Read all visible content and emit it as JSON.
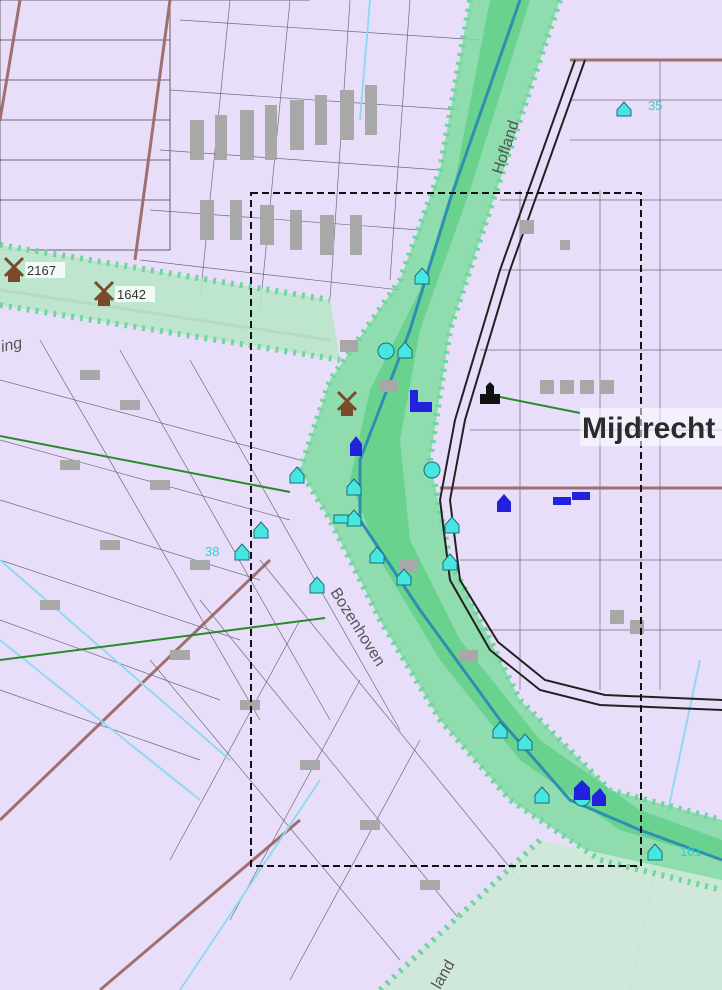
{
  "map": {
    "background_color": "#e9defa",
    "zone_color": "#5fd18a",
    "building_color": "#a8a8a8",
    "water_color": "#8fd9f2",
    "place_label": "Mijdrecht",
    "street_labels": [
      "Hofland",
      "Bozenhoven",
      "ing",
      "land"
    ],
    "windmills": [
      {
        "id": "2167",
        "label": "2167",
        "icon": "windmill-x-icon"
      },
      {
        "id": "1642",
        "label": "1642",
        "icon": "windmill-x-icon"
      },
      {
        "id": "center",
        "label": "",
        "icon": "windmill-x-icon"
      }
    ],
    "number_labels": [
      "35",
      "38",
      "101"
    ],
    "church_icon": "church-icon"
  }
}
